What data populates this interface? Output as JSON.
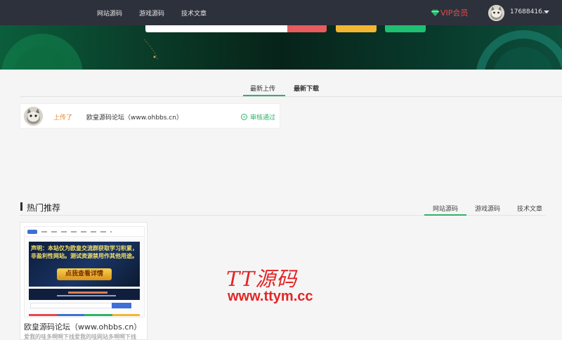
{
  "nav": {
    "links": [
      "网站源码",
      "游戏源码",
      "技术文章"
    ],
    "vip_label": "VIP会员",
    "username": "17688416...",
    "colors": {
      "bg": "#2d313b",
      "vip": "#e54b4b"
    }
  },
  "tabs": {
    "latest_upload": "最新上传",
    "latest_download": "最新下载"
  },
  "upload": {
    "action": "上传了",
    "title": "欧皇源码论坛（www.ohbbs.cn）",
    "status": "审核通过"
  },
  "hot": {
    "title": "热门推荐",
    "tabs": [
      "网站源码",
      "游戏源码",
      "技术文章"
    ]
  },
  "card": {
    "thumb_banner_text": "声明：本站仅为欧皇交流群获取学习积累，非盈利性网站。测试资源禁用作其他用途。",
    "thumb_button": "点我查看详情",
    "title": "欧皇源码论坛（www.ohbbs.cn）",
    "description": "爱我的哇多啊啊下线爱我的哇网站多啊啊下线"
  },
  "watermark": {
    "logo": "TT源码",
    "url": "www.ttym.cc"
  },
  "accent": "#2db36a"
}
